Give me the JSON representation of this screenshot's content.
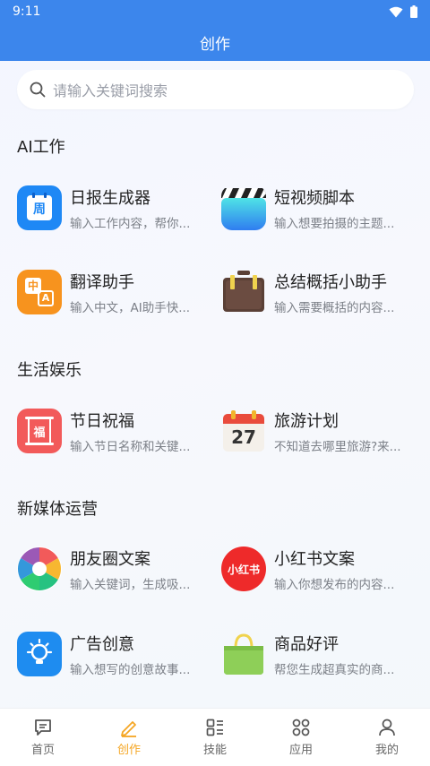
{
  "status": {
    "time": "9:11"
  },
  "header": {
    "title": "创作"
  },
  "search": {
    "placeholder": "请输入关键词搜索"
  },
  "sections": [
    {
      "title": "AI工作",
      "items": [
        {
          "title": "日报生成器",
          "subtitle": "输入工作内容，帮你...",
          "icon": "calendar-week-icon",
          "glyph": "周"
        },
        {
          "title": "短视频脚本",
          "subtitle": "输入想要拍摄的主题...",
          "icon": "clapperboard-icon"
        },
        {
          "title": "翻译助手",
          "subtitle": "输入中文，AI助手快...",
          "icon": "translate-icon",
          "glyph1": "中",
          "glyph2": "A"
        },
        {
          "title": "总结概括小助手",
          "subtitle": "输入需要概括的内容...",
          "icon": "briefcase-icon"
        }
      ]
    },
    {
      "title": "生活娱乐",
      "items": [
        {
          "title": "节日祝福",
          "subtitle": "输入节日名称和关键...",
          "icon": "blessing-scroll-icon",
          "glyph": "福"
        },
        {
          "title": "旅游计划",
          "subtitle": "不知道去哪里旅游?来...",
          "icon": "calendar-icon",
          "glyph": "27"
        }
      ]
    },
    {
      "title": "新媒体运营",
      "items": [
        {
          "title": "朋友圈文案",
          "subtitle": "输入关键词，生成吸...",
          "icon": "aperture-icon"
        },
        {
          "title": "小红书文案",
          "subtitle": "输入你想发布的内容...",
          "icon": "xiaohongshu-icon",
          "glyph": "小红书"
        },
        {
          "title": "广告创意",
          "subtitle": "输入想写的创意故事...",
          "icon": "lightbulb-icon"
        },
        {
          "title": "商品好评",
          "subtitle": "帮您生成超真实的商...",
          "icon": "shopping-bag-icon"
        }
      ]
    }
  ],
  "tabs": [
    {
      "label": "首页",
      "icon": "message-square-icon",
      "active": false
    },
    {
      "label": "创作",
      "icon": "pencil-icon",
      "active": true
    },
    {
      "label": "技能",
      "icon": "grid-list-icon",
      "active": false
    },
    {
      "label": "应用",
      "icon": "command-icon",
      "active": false
    },
    {
      "label": "我的",
      "icon": "user-icon",
      "active": false
    }
  ],
  "colors": {
    "primary": "#3c86ec",
    "active_tab": "#f5a623"
  }
}
